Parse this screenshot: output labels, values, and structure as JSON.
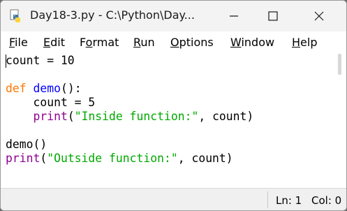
{
  "window": {
    "title": "Day18-3.py - C:\\Python\\Day..."
  },
  "menu": {
    "file": {
      "u": "F",
      "rest": "ile"
    },
    "edit": {
      "u": "E",
      "rest": "dit"
    },
    "format": {
      "pre": "F",
      "u": "o",
      "rest": "rmat"
    },
    "run": {
      "u": "R",
      "rest": "un"
    },
    "options": {
      "u": "O",
      "rest": "ptions"
    },
    "window": {
      "u": "W",
      "rest": "indow"
    },
    "help": {
      "u": "H",
      "rest": "elp"
    }
  },
  "code": {
    "line1": "count = 10",
    "line3_kw": "def",
    "line3_name": "demo",
    "line3_rest": "():",
    "line4": "    count = 5",
    "line5_indent": "    ",
    "line5_builtin": "print",
    "line5_open": "(",
    "line5_str": "\"Inside function:\"",
    "line5_rest": ", count)",
    "line7": "demo()",
    "line8_builtin": "print",
    "line8_open": "(",
    "line8_str": "\"Outside function:\"",
    "line8_rest": ", count)"
  },
  "status": {
    "ln": "Ln: 1",
    "col": "Col: 0"
  },
  "colors": {
    "keyword": "#ff7700",
    "definition": "#0000ff",
    "builtin": "#900090",
    "string": "#00aa00"
  },
  "icons": [
    "python-idle-icon",
    "minimize-icon",
    "maximize-icon",
    "close-icon"
  ]
}
